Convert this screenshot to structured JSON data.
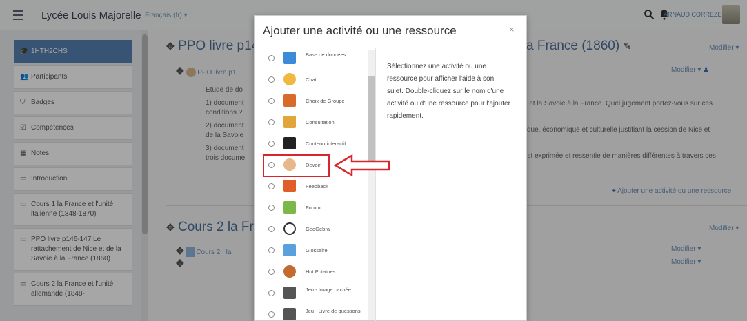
{
  "header": {
    "site_name": "Lycée Louis Majorelle",
    "language": "Français (fr) ▾",
    "user_name": "ARNAUD CORREZE"
  },
  "drawer": {
    "items": [
      {
        "label": "1HTH2CHS",
        "icon": "cap-icon",
        "active": true
      },
      {
        "label": "Participants",
        "icon": "users-icon"
      },
      {
        "label": "Badges",
        "icon": "shield-icon"
      },
      {
        "label": "Compétences",
        "icon": "check-square-icon"
      },
      {
        "label": "Notes",
        "icon": "table-icon"
      },
      {
        "label": "Introduction",
        "icon": "folder-icon"
      },
      {
        "label": "Cours 1 la France et l'unité italienne (1848-1870)",
        "icon": "folder-icon"
      },
      {
        "label": "PPO livre p146-147 Le rattachement de Nice et de la Savoie à la France (1860)",
        "icon": "folder-icon"
      },
      {
        "label": "Cours 2 la France et l'unité allemande (1848-",
        "icon": "folder-icon"
      }
    ]
  },
  "main": {
    "section1_title_left": "PPO livre p14",
    "section1_title_right": "a France (1860)",
    "section1_edit": "Modifier ▾",
    "activity1_link": "PPO livre p1",
    "activity1_edit": "Modifier ▾",
    "para_left": [
      "Etude de do",
      "1) document",
      "conditions ?",
      "2) document",
      "de la Savoie",
      "3) document",
      "trois docume"
    ],
    "para_right_1": "e et la Savoie à la France. Quel jugement portez-vous sur ces",
    "para_right_2": "tique, économique et culturelle justifiant la cession de Nice et",
    "para_right_3": "est exprimée et ressentie de manières différentes à travers ces",
    "add_activity": "Ajouter une activité ou une ressource",
    "section2_title": "Cours 2 la Fr",
    "section2_edit": "Modifier ▾",
    "activity2_link": "Cours 2 : la",
    "activity2_edit": "Modifier ▾",
    "activity3_edit": "Modifier ▾"
  },
  "modal": {
    "title": "Ajouter une activité ou une ressource",
    "close": "×",
    "help_text": "Sélectionnez une activité ou une ressource pour afficher l'aide à son sujet. Double-cliquez sur le nom d'une activité ou d'une ressource pour l'ajouter rapidement.",
    "options": [
      {
        "label": "Base de données",
        "icon": "database-icon",
        "color": "#3c8bd9"
      },
      {
        "label": "Chat",
        "icon": "chat-icon",
        "color": "#f0b840"
      },
      {
        "label": "Choix de Groupe",
        "icon": "group-choice-icon",
        "color": "#d86a2a"
      },
      {
        "label": "Consultation",
        "icon": "survey-icon",
        "color": "#e2a53a"
      },
      {
        "label": "Contenu interactif",
        "icon": "h5p-icon",
        "color": "#222222"
      },
      {
        "label": "Devoir",
        "icon": "assignment-icon",
        "color": "#e6b88a"
      },
      {
        "label": "Feedback",
        "icon": "feedback-icon",
        "color": "#e05e2a"
      },
      {
        "label": "Forum",
        "icon": "forum-icon",
        "color": "#7bb84a"
      },
      {
        "label": "GeoGebra",
        "icon": "geogebra-icon",
        "color": "#333333"
      },
      {
        "label": "Glossaire",
        "icon": "glossary-icon",
        "color": "#5aa0dc"
      },
      {
        "label": "Hot Potatoes",
        "icon": "hotpot-icon",
        "color": "#c26a30"
      },
      {
        "label": "Jeu - Image cachée",
        "icon": "puzzle-icon",
        "color": "#555555"
      },
      {
        "label": "Jeu - Livre de questions",
        "icon": "puzzle-icon",
        "color": "#555555"
      }
    ]
  }
}
